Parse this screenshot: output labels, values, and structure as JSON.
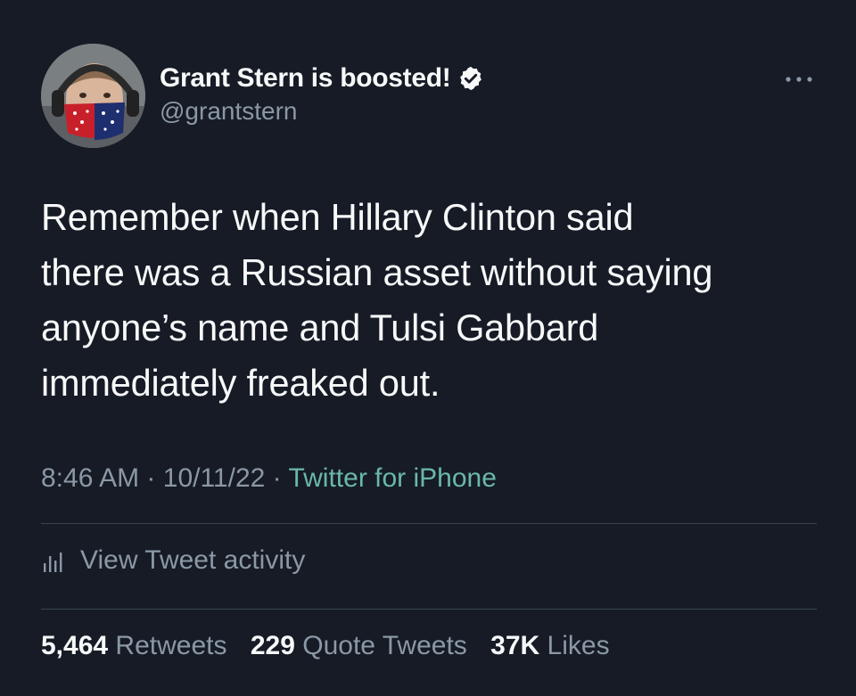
{
  "tweet": {
    "author": {
      "display_name": "Grant Stern is boosted!",
      "handle": "@grantstern",
      "verified": true
    },
    "text": "Remember when Hillary Clinton said\nthere was a Russian asset without saying\nanyone’s name and Tulsi Gabbard\nimmediately freaked out.",
    "time": "8:46 AM",
    "date": "10/11/22",
    "separator": "·",
    "source": "Twitter for iPhone",
    "activity_label": "View Tweet activity",
    "stats": {
      "retweets": {
        "count": "5,464",
        "label": "Retweets"
      },
      "quote_tweets": {
        "count": "229",
        "label": "Quote Tweets"
      },
      "likes": {
        "count": "37K",
        "label": "Likes"
      }
    }
  },
  "colors": {
    "background": "#161b26",
    "primary_text": "#f7f9f9",
    "secondary_text": "#8b98a5",
    "source_link": "#6ab8a8",
    "divider": "#38444d"
  },
  "icons": {
    "verified": "verified-badge-icon",
    "more": "more-horizontal-icon",
    "activity": "bar-chart-icon"
  }
}
